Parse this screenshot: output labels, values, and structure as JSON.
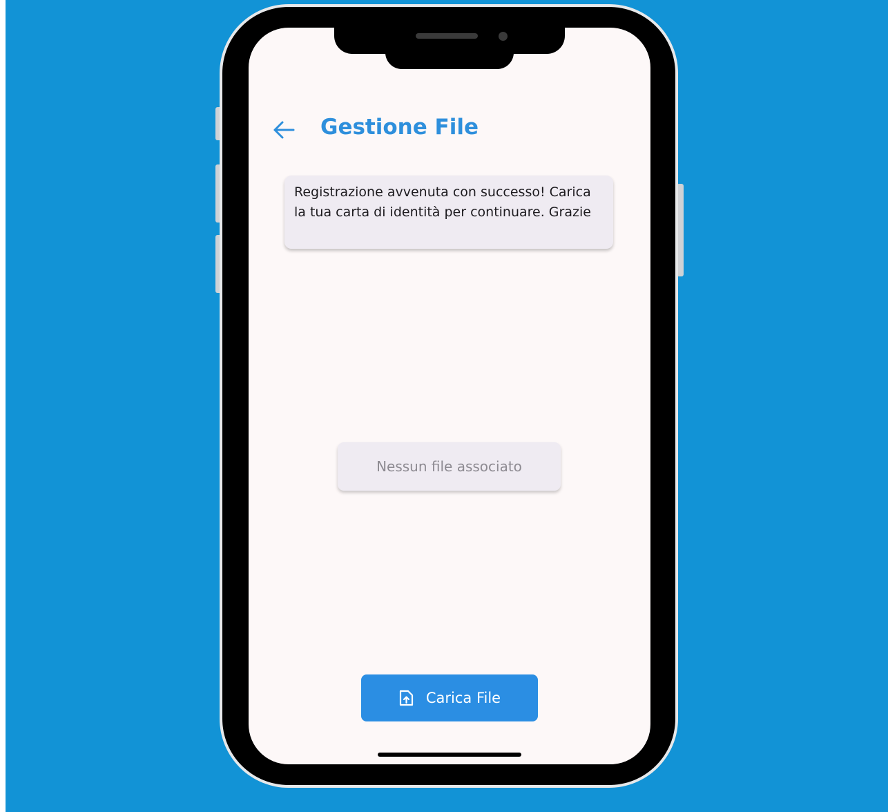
{
  "header": {
    "title": "Gestione File"
  },
  "message": {
    "text": "Registrazione avvenuta con successo! Carica la tua carta di identità per continuare. Grazie"
  },
  "files": {
    "empty_text": "Nessun file associato"
  },
  "actions": {
    "upload_label": "Carica File",
    "upload_icon": "upload-file-icon",
    "back_icon": "arrow-left-icon"
  },
  "colors": {
    "background": "#1293d6",
    "accent": "#2e8fdc",
    "button": "#2b8ee3",
    "card": "#efebf2",
    "screen": "#fdf8f8"
  }
}
